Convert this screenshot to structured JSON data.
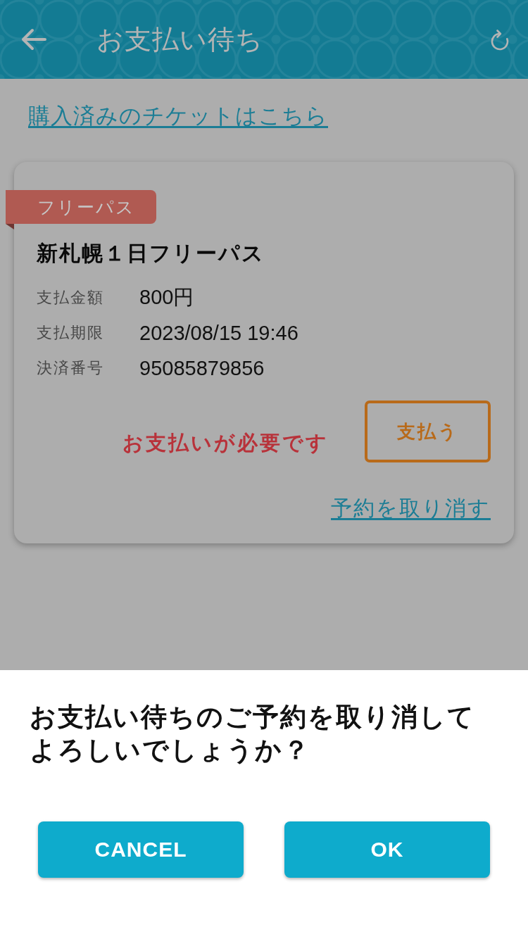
{
  "header": {
    "title": "お支払い待ち"
  },
  "purchased_link": "購入済みのチケットはこちら",
  "tickets": [
    {
      "tag": "フリーパス",
      "title": "新札幌１日フリーパス",
      "details": [
        {
          "label": "支払金額",
          "value": "800円"
        },
        {
          "label": "支払期限",
          "value": "2023/08/15 19:46"
        },
        {
          "label": "決済番号",
          "value": "95085879856"
        }
      ],
      "status": "お支払いが必要です",
      "pay_button": "支払う",
      "cancel_link": "予約を取り消す"
    }
  ],
  "dialog": {
    "message": "お支払い待ちのご予約を取り消してよろしいでしょうか？",
    "buttons": [
      {
        "label": "CANCEL"
      },
      {
        "label": "OK"
      }
    ]
  }
}
